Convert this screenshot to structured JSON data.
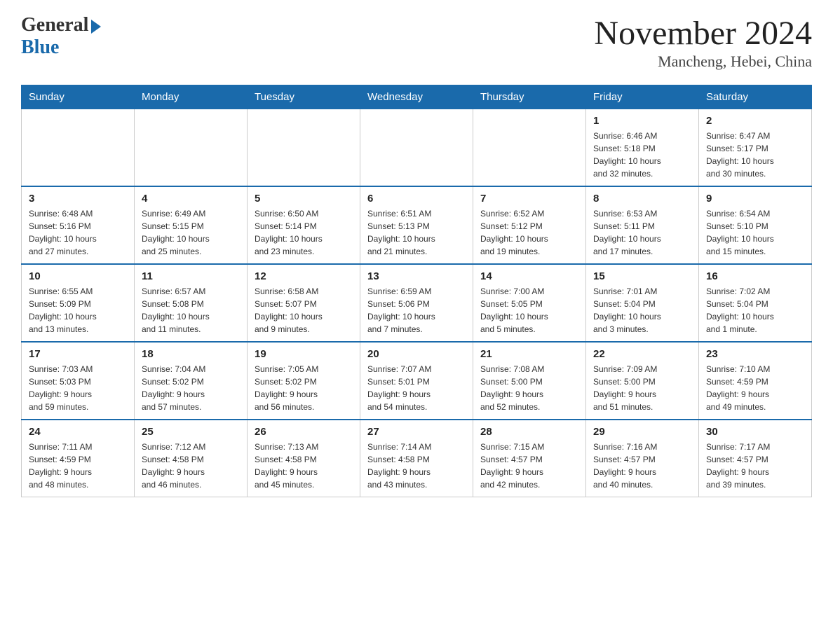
{
  "header": {
    "logo_general": "General",
    "logo_blue": "Blue",
    "month_year": "November 2024",
    "location": "Mancheng, Hebei, China"
  },
  "days_of_week": [
    "Sunday",
    "Monday",
    "Tuesday",
    "Wednesday",
    "Thursday",
    "Friday",
    "Saturday"
  ],
  "weeks": [
    [
      {
        "day": "",
        "info": ""
      },
      {
        "day": "",
        "info": ""
      },
      {
        "day": "",
        "info": ""
      },
      {
        "day": "",
        "info": ""
      },
      {
        "day": "",
        "info": ""
      },
      {
        "day": "1",
        "info": "Sunrise: 6:46 AM\nSunset: 5:18 PM\nDaylight: 10 hours\nand 32 minutes."
      },
      {
        "day": "2",
        "info": "Sunrise: 6:47 AM\nSunset: 5:17 PM\nDaylight: 10 hours\nand 30 minutes."
      }
    ],
    [
      {
        "day": "3",
        "info": "Sunrise: 6:48 AM\nSunset: 5:16 PM\nDaylight: 10 hours\nand 27 minutes."
      },
      {
        "day": "4",
        "info": "Sunrise: 6:49 AM\nSunset: 5:15 PM\nDaylight: 10 hours\nand 25 minutes."
      },
      {
        "day": "5",
        "info": "Sunrise: 6:50 AM\nSunset: 5:14 PM\nDaylight: 10 hours\nand 23 minutes."
      },
      {
        "day": "6",
        "info": "Sunrise: 6:51 AM\nSunset: 5:13 PM\nDaylight: 10 hours\nand 21 minutes."
      },
      {
        "day": "7",
        "info": "Sunrise: 6:52 AM\nSunset: 5:12 PM\nDaylight: 10 hours\nand 19 minutes."
      },
      {
        "day": "8",
        "info": "Sunrise: 6:53 AM\nSunset: 5:11 PM\nDaylight: 10 hours\nand 17 minutes."
      },
      {
        "day": "9",
        "info": "Sunrise: 6:54 AM\nSunset: 5:10 PM\nDaylight: 10 hours\nand 15 minutes."
      }
    ],
    [
      {
        "day": "10",
        "info": "Sunrise: 6:55 AM\nSunset: 5:09 PM\nDaylight: 10 hours\nand 13 minutes."
      },
      {
        "day": "11",
        "info": "Sunrise: 6:57 AM\nSunset: 5:08 PM\nDaylight: 10 hours\nand 11 minutes."
      },
      {
        "day": "12",
        "info": "Sunrise: 6:58 AM\nSunset: 5:07 PM\nDaylight: 10 hours\nand 9 minutes."
      },
      {
        "day": "13",
        "info": "Sunrise: 6:59 AM\nSunset: 5:06 PM\nDaylight: 10 hours\nand 7 minutes."
      },
      {
        "day": "14",
        "info": "Sunrise: 7:00 AM\nSunset: 5:05 PM\nDaylight: 10 hours\nand 5 minutes."
      },
      {
        "day": "15",
        "info": "Sunrise: 7:01 AM\nSunset: 5:04 PM\nDaylight: 10 hours\nand 3 minutes."
      },
      {
        "day": "16",
        "info": "Sunrise: 7:02 AM\nSunset: 5:04 PM\nDaylight: 10 hours\nand 1 minute."
      }
    ],
    [
      {
        "day": "17",
        "info": "Sunrise: 7:03 AM\nSunset: 5:03 PM\nDaylight: 9 hours\nand 59 minutes."
      },
      {
        "day": "18",
        "info": "Sunrise: 7:04 AM\nSunset: 5:02 PM\nDaylight: 9 hours\nand 57 minutes."
      },
      {
        "day": "19",
        "info": "Sunrise: 7:05 AM\nSunset: 5:02 PM\nDaylight: 9 hours\nand 56 minutes."
      },
      {
        "day": "20",
        "info": "Sunrise: 7:07 AM\nSunset: 5:01 PM\nDaylight: 9 hours\nand 54 minutes."
      },
      {
        "day": "21",
        "info": "Sunrise: 7:08 AM\nSunset: 5:00 PM\nDaylight: 9 hours\nand 52 minutes."
      },
      {
        "day": "22",
        "info": "Sunrise: 7:09 AM\nSunset: 5:00 PM\nDaylight: 9 hours\nand 51 minutes."
      },
      {
        "day": "23",
        "info": "Sunrise: 7:10 AM\nSunset: 4:59 PM\nDaylight: 9 hours\nand 49 minutes."
      }
    ],
    [
      {
        "day": "24",
        "info": "Sunrise: 7:11 AM\nSunset: 4:59 PM\nDaylight: 9 hours\nand 48 minutes."
      },
      {
        "day": "25",
        "info": "Sunrise: 7:12 AM\nSunset: 4:58 PM\nDaylight: 9 hours\nand 46 minutes."
      },
      {
        "day": "26",
        "info": "Sunrise: 7:13 AM\nSunset: 4:58 PM\nDaylight: 9 hours\nand 45 minutes."
      },
      {
        "day": "27",
        "info": "Sunrise: 7:14 AM\nSunset: 4:58 PM\nDaylight: 9 hours\nand 43 minutes."
      },
      {
        "day": "28",
        "info": "Sunrise: 7:15 AM\nSunset: 4:57 PM\nDaylight: 9 hours\nand 42 minutes."
      },
      {
        "day": "29",
        "info": "Sunrise: 7:16 AM\nSunset: 4:57 PM\nDaylight: 9 hours\nand 40 minutes."
      },
      {
        "day": "30",
        "info": "Sunrise: 7:17 AM\nSunset: 4:57 PM\nDaylight: 9 hours\nand 39 minutes."
      }
    ]
  ]
}
